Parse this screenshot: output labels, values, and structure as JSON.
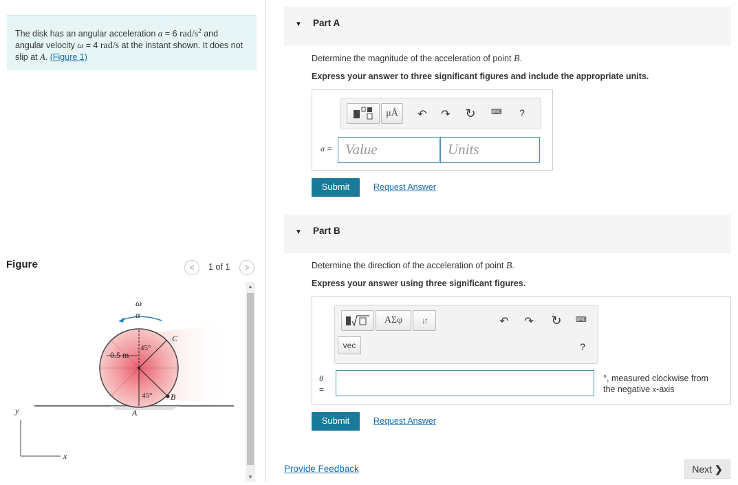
{
  "problem": {
    "text_pre": "The disk has an angular acceleration ",
    "alpha_sym": "α",
    "alpha_eq": " = 6 ",
    "alpha_unit": "rad/s",
    "alpha_exp": "2",
    "and1": " and angular velocity ",
    "omega_sym": "ω",
    "omega_eq": " = 4 ",
    "omega_unit": "rad/s",
    "text_mid": " at the instant shown. It does not slip at ",
    "point": "A",
    "text_end": ". ",
    "figure_link": "(Figure 1)"
  },
  "figure": {
    "title": "Figure",
    "pager": "1 of 1",
    "prev": "<",
    "next": ">",
    "labels": {
      "omega": "ω",
      "alpha": "α",
      "radius": "0.5 m",
      "angle_top": "45°",
      "angle_bottom": "45°",
      "point_c": "C",
      "point_b": "B",
      "point_a": "A",
      "axis_y": "y",
      "axis_x": "x"
    }
  },
  "partA": {
    "title": "Part A",
    "question_pre": "Determine the magnitude of the acceleration of point ",
    "question_point": "B",
    "question_end": ".",
    "instruction": "Express your answer to three significant figures and include the appropriate units.",
    "toolbar_units_btn": "μÅ",
    "help": "?",
    "var_label": "a =",
    "value_placeholder": "Value",
    "units_placeholder": "Units",
    "submit": "Submit",
    "request": "Request Answer"
  },
  "partB": {
    "title": "Part B",
    "question_pre": "Determine the direction of the acceleration of point ",
    "question_point": "B",
    "question_end": ".",
    "instruction": "Express your answer using three significant figures.",
    "toolbar_sqrt": "√",
    "toolbar_greek": "ΑΣφ",
    "toolbar_sort": "↓↑",
    "toolbar_vec": "vec",
    "help": "?",
    "var_label_top": "θ",
    "var_label_bottom": "=",
    "suffix_line1": "°, measured clockwise from",
    "suffix_line2_pre": "the negative ",
    "suffix_axis": "x",
    "suffix_line2_post": "-axis",
    "submit": "Submit",
    "request": "Request Answer"
  },
  "footer": {
    "feedback": "Provide Feedback",
    "next": "Next"
  }
}
